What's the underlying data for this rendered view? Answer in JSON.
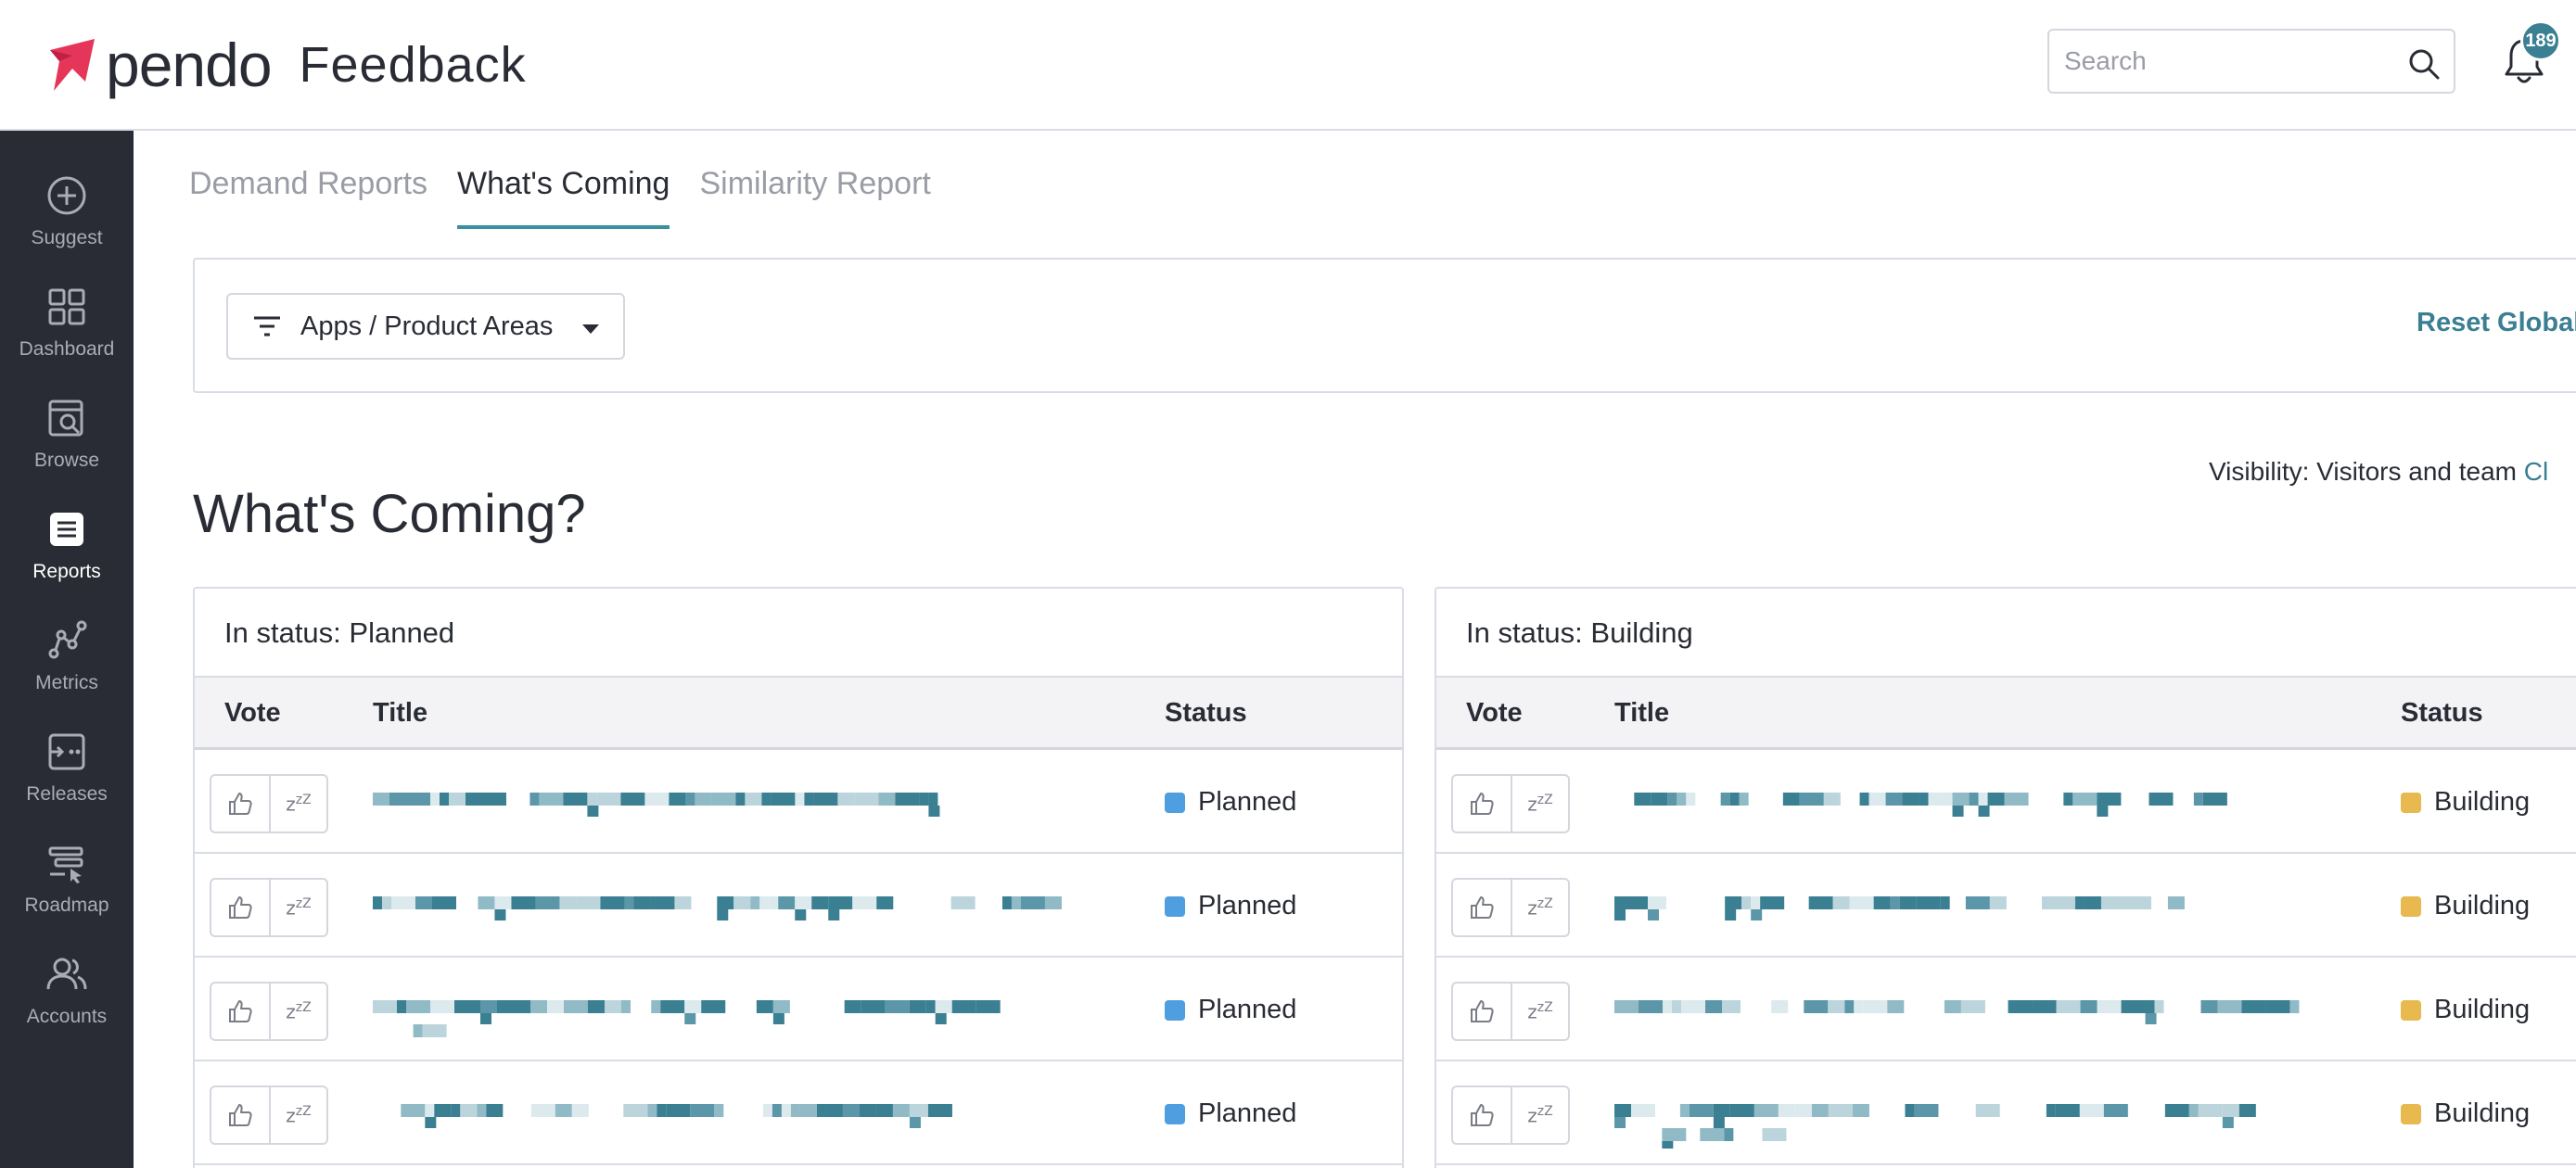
{
  "header": {
    "brand": "pendo",
    "product": "Feedback",
    "search_placeholder": "Search",
    "notifications_count": "189"
  },
  "sidebar": {
    "items": [
      {
        "label": "Suggest",
        "icon": "plus-circle-icon"
      },
      {
        "label": "Dashboard",
        "icon": "grid-icon"
      },
      {
        "label": "Browse",
        "icon": "browse-search-icon"
      },
      {
        "label": "Reports",
        "icon": "reports-list-icon",
        "active": true
      },
      {
        "label": "Metrics",
        "icon": "metrics-nodes-icon"
      },
      {
        "label": "Releases",
        "icon": "releases-icon"
      },
      {
        "label": "Roadmap",
        "icon": "roadmap-icon"
      },
      {
        "label": "Accounts",
        "icon": "accounts-users-icon"
      }
    ]
  },
  "tabs": [
    {
      "label": "Demand Reports",
      "active": false
    },
    {
      "label": "What's Coming",
      "active": true
    },
    {
      "label": "Similarity Report",
      "active": false
    }
  ],
  "filters": {
    "apps_label": "Apps / Product Areas",
    "reset_label": "Reset Global Filte"
  },
  "visibility": {
    "label": "Visibility: Visitors and team",
    "change_link": "Cl"
  },
  "page": {
    "heading": "What's Coming?"
  },
  "columns": {
    "vote": "Vote",
    "title": "Title",
    "status": "Status"
  },
  "planned": {
    "title": "In status: Planned",
    "status_label": "Planned",
    "status_color": "#4f9fe0",
    "row_count": 4
  },
  "building": {
    "title": "In status: Building",
    "status_label": "Building",
    "status_color": "#e7b94f",
    "row_count": 4
  },
  "colors": {
    "accent": "#3a7f92",
    "sidebar_bg": "#2a2c35",
    "brand_pink": "#e5365a"
  }
}
